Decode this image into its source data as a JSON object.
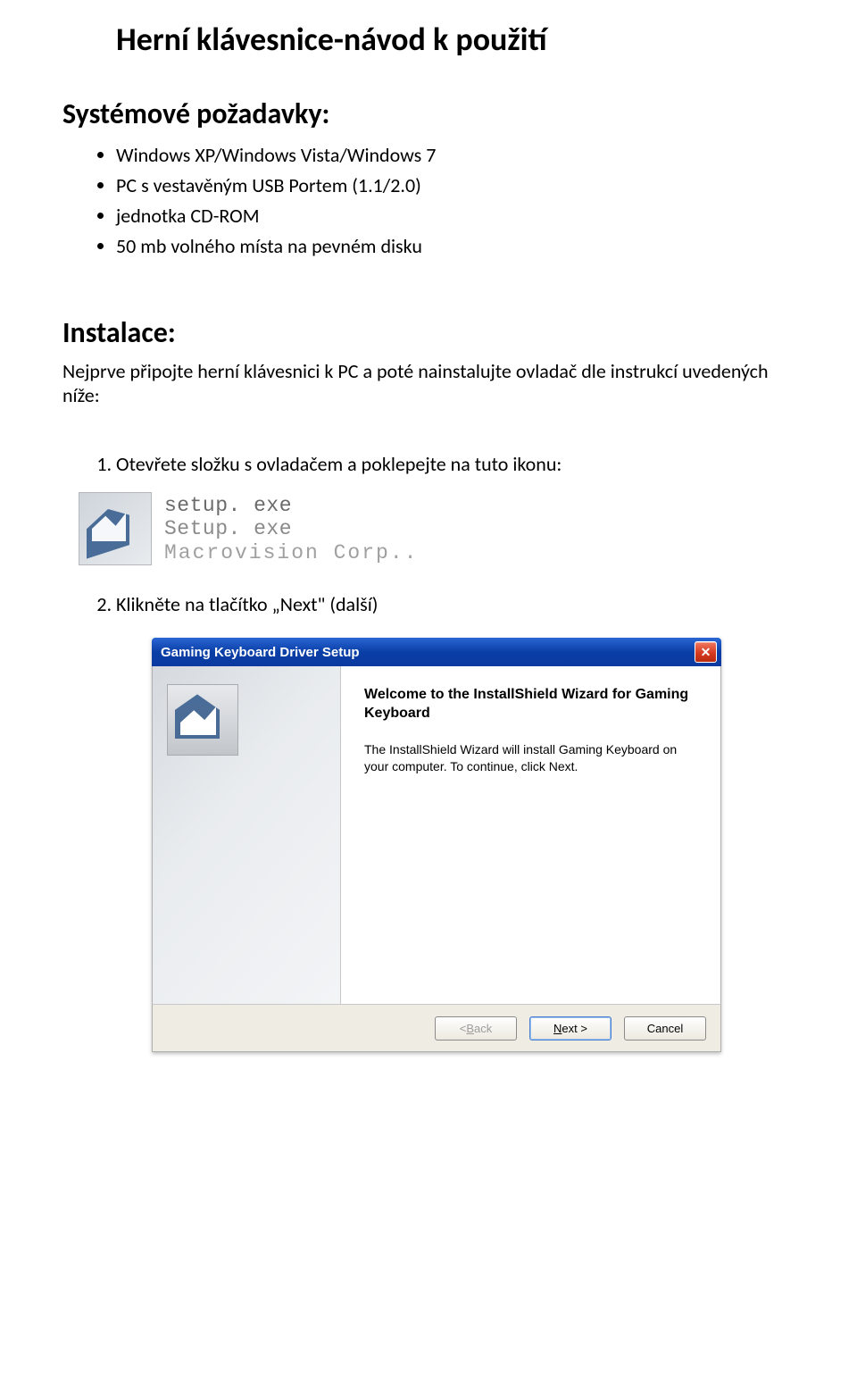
{
  "title": "Herní klávesnice-návod k použití",
  "sections": {
    "requirements_heading": "Systémové požadavky:",
    "requirements": [
      "Windows XP/Windows Vista/Windows 7",
      "PC s vestavěným USB Portem (1.1/2.0)",
      "jednotka CD-ROM",
      "50 mb volného místa na pevném disku"
    ],
    "install_heading": "Instalace:",
    "install_intro": "Nejprve připojte herní klávesnici k PC a poté nainstalujte ovladač dle instrukcí uvedených níže:",
    "steps": [
      "Otevřete složku s ovladačem a poklepejte na tuto ikonu:",
      "Klikněte na tlačítko „Next\" (další)"
    ]
  },
  "setup_icon": {
    "line1": "setup. exe",
    "line2": "Setup. exe",
    "line3": "Macrovision Corp.."
  },
  "wizard": {
    "title": "Gaming Keyboard Driver Setup",
    "close_glyph": "✕",
    "heading": "Welcome to the InstallShield Wizard for Gaming Keyboard",
    "description": "The InstallShield Wizard will install Gaming Keyboard on your computer.  To continue, click Next.",
    "buttons": {
      "back_prefix": "< ",
      "back_u": "B",
      "back_rest": "ack",
      "next_u": "N",
      "next_rest": "ext >",
      "cancel": "Cancel"
    }
  }
}
